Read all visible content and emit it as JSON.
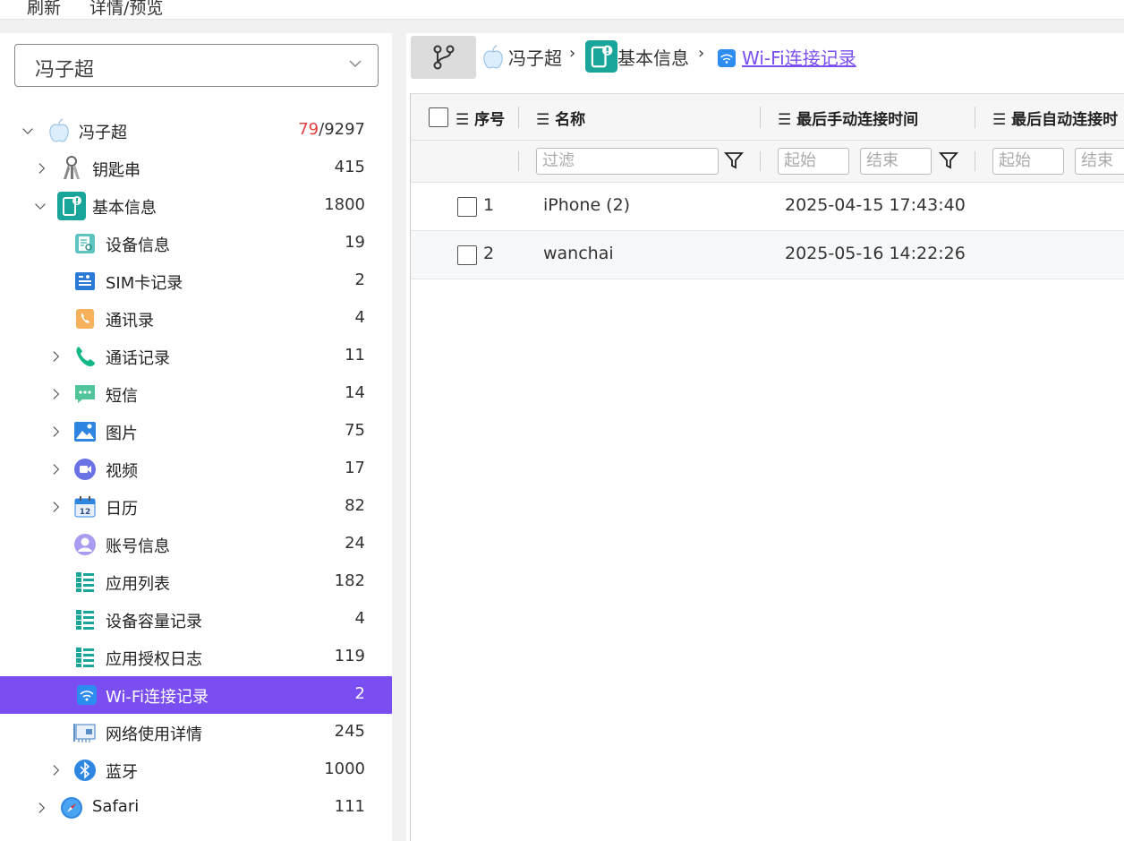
{
  "menubar": {
    "refresh": "刷新",
    "detail": "详情/预览"
  },
  "case_select": {
    "value": "冯子超"
  },
  "tree": [
    {
      "label": "冯子超",
      "count_red": "79",
      "count_rest": "/9297",
      "icon": "apple-icon"
    },
    {
      "label": "钥匙串",
      "count": "415",
      "icon": "keychain-icon"
    },
    {
      "label": "基本信息",
      "count": "1800",
      "icon": "device-info-icon"
    },
    {
      "label": "设备信息",
      "count": "19",
      "icon": "device-doc-icon"
    },
    {
      "label": "SIM卡记录",
      "count": "2",
      "icon": "sim-card-icon"
    },
    {
      "label": "通讯录",
      "count": "4",
      "icon": "contacts-icon"
    },
    {
      "label": "通话记录",
      "count": "11",
      "icon": "phone-icon"
    },
    {
      "label": "短信",
      "count": "14",
      "icon": "sms-icon"
    },
    {
      "label": "图片",
      "count": "75",
      "icon": "picture-icon"
    },
    {
      "label": "视频",
      "count": "17",
      "icon": "video-icon"
    },
    {
      "label": "日历",
      "count": "82",
      "icon": "calendar-icon"
    },
    {
      "label": "账号信息",
      "count": "24",
      "icon": "account-icon"
    },
    {
      "label": "应用列表",
      "count": "182",
      "icon": "list-icon"
    },
    {
      "label": "设备容量记录",
      "count": "4",
      "icon": "list-icon"
    },
    {
      "label": "应用授权日志",
      "count": "119",
      "icon": "list-icon"
    },
    {
      "label": "Wi-Fi连接记录",
      "count": "2",
      "icon": "wifi-icon"
    },
    {
      "label": "网络使用详情",
      "count": "245",
      "icon": "network-card-icon"
    },
    {
      "label": "蓝牙",
      "count": "1000",
      "icon": "bluetooth-icon"
    },
    {
      "label": "Safari",
      "count": "111",
      "icon": "safari-icon"
    }
  ],
  "breadcrumb": {
    "root": "冯子超",
    "parent": "基本信息",
    "current": "Wi-Fi连接记录"
  },
  "table": {
    "columns": [
      "序号",
      "名称",
      "最后手动连接时间",
      "最后自动连接时"
    ],
    "filter": {
      "placeholder": "过滤",
      "start": "起始",
      "end": "结束"
    },
    "rows": [
      {
        "index": "1",
        "name": "iPhone (2)",
        "manual_time": "2025-04-15 17:43:40"
      },
      {
        "index": "2",
        "name": "wanchai",
        "manual_time": "2025-05-16 14:22:26"
      }
    ]
  },
  "colors": {
    "accent": "#7a4ef0",
    "count_highlight": "#e04040"
  }
}
